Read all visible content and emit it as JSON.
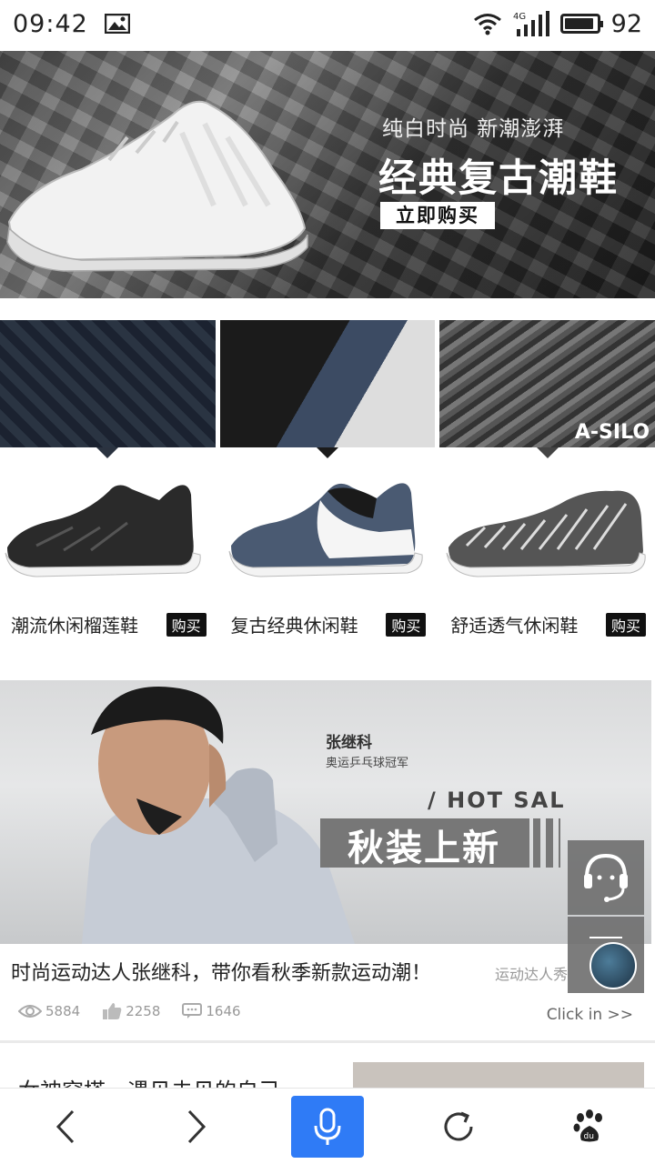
{
  "status_bar": {
    "time": "09:42",
    "network": "4G",
    "battery": "92",
    "battery_level": 0.92
  },
  "banner": {
    "subtitle": "纯白时尚 新潮澎湃",
    "title": "经典复古潮鞋",
    "cta": "立即购买"
  },
  "products": [
    {
      "name": "潮流休闲榴莲鞋",
      "buy": "购买"
    },
    {
      "name": "复古经典休闲鞋",
      "buy": "购买"
    },
    {
      "name": "舒适透气休闲鞋",
      "buy": "购买",
      "overlay": "A-SILO"
    }
  ],
  "article": {
    "athlete_name": "张继科",
    "athlete_title": "奥运乒乓球冠军",
    "hot_sale": "/ HOT SAL",
    "headline_overlay": "秋装上新",
    "title": "时尚运动达人张继科，带你看秋季新款运动潮！",
    "tag": "运动达人秀",
    "views": "5884",
    "likes": "2258",
    "comments": "1646",
    "click_in": "Click in >>"
  },
  "next_card": {
    "title": "女神穿搭，遇见未见的自己"
  },
  "nav": {
    "back": "back-icon",
    "forward": "forward-icon",
    "voice": "microphone-icon",
    "refresh": "refresh-icon",
    "home": "baidu-paw-icon",
    "accent": "#2f7bf6"
  }
}
